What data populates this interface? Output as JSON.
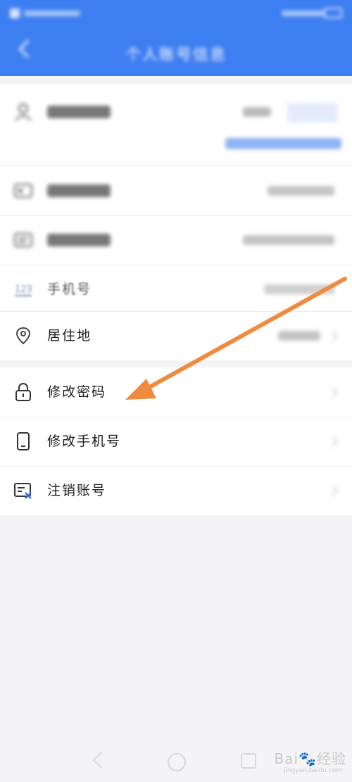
{
  "header": {
    "title": "个人账号信息",
    "background": "#3d7ef0"
  },
  "rows": {
    "phone": {
      "label": "手机号"
    },
    "residence": {
      "label": "居住地"
    },
    "change_password": {
      "label": "修改密码"
    },
    "change_phone": {
      "label": "修改手机号"
    },
    "cancel_account": {
      "label": "注销账号"
    }
  },
  "icons": {
    "back": "chevron-left-icon",
    "name": "person-icon",
    "id_type": "id-card-icon",
    "id_number": "id-card-icon",
    "phone": "phone-number-icon",
    "residence": "location-pin-icon",
    "change_password": "lock-icon",
    "change_phone": "mobile-phone-icon",
    "cancel_account": "account-cancel-icon"
  },
  "annotation": {
    "color": "#f08a3c"
  },
  "watermark": {
    "brand": "Bai",
    "brand_suffix": "经验",
    "url": "jingyan.baidu.com"
  }
}
